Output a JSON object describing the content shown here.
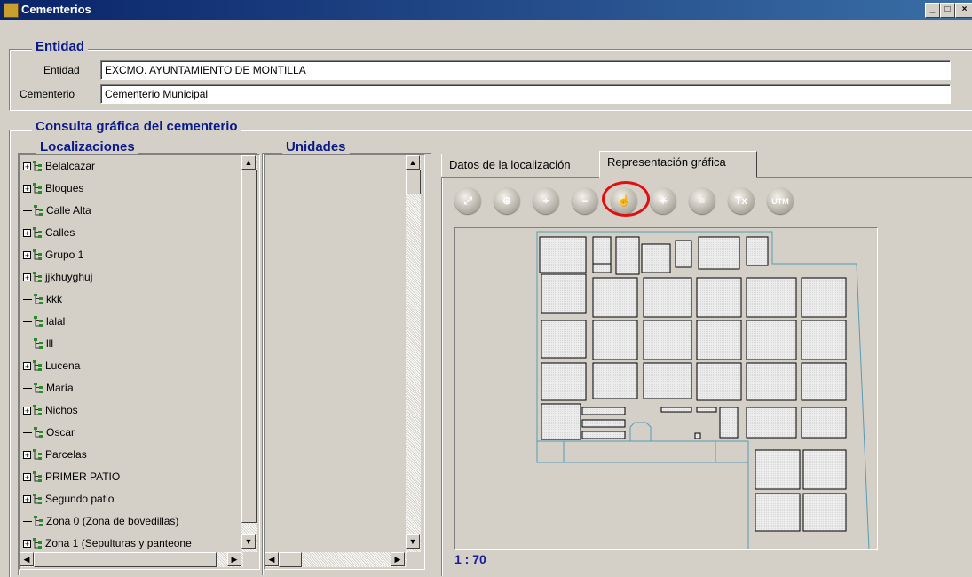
{
  "window": {
    "title": "Cementerios"
  },
  "entidad_section": {
    "title": "Entidad",
    "entidad_label": "Entidad",
    "entidad_value": "EXCMO. AYUNTAMIENTO DE MONTILLA",
    "cementerio_label": "Cementerio",
    "cementerio_value": "Cementerio Municipal"
  },
  "consulta_section": {
    "title": "Consulta gráfica del cementerio",
    "localizaciones_title": "Localizaciones",
    "unidades_title": "Unidades"
  },
  "localizaciones": [
    {
      "label": "Belalcazar",
      "expandable": true
    },
    {
      "label": "Bloques",
      "expandable": true
    },
    {
      "label": "Calle Alta",
      "expandable": false
    },
    {
      "label": "Calles",
      "expandable": true
    },
    {
      "label": "Grupo 1",
      "expandable": true
    },
    {
      "label": "jjkhuyghuj",
      "expandable": true
    },
    {
      "label": "kkk",
      "expandable": false
    },
    {
      "label": "lalal",
      "expandable": false
    },
    {
      "label": "lll",
      "expandable": false
    },
    {
      "label": "Lucena",
      "expandable": true
    },
    {
      "label": "María",
      "expandable": false
    },
    {
      "label": "Nichos",
      "expandable": true
    },
    {
      "label": "Oscar",
      "expandable": false
    },
    {
      "label": "Parcelas",
      "expandable": true
    },
    {
      "label": "PRIMER PATIO",
      "expandable": true
    },
    {
      "label": "Segundo patio",
      "expandable": true
    },
    {
      "label": "Zona 0 (Zona de bovedillas)",
      "expandable": false
    },
    {
      "label": "Zona 1 (Sepulturas y panteone",
      "expandable": true
    }
  ],
  "tabs": [
    {
      "label": "Datos de la localización",
      "active": false
    },
    {
      "label": "Representación gráfica",
      "active": true
    }
  ],
  "toolbar": [
    {
      "icon": "zoom-extent-icon",
      "glyph": "⤢"
    },
    {
      "icon": "zoom-window-icon",
      "glyph": "⊕"
    },
    {
      "icon": "zoom-in-icon",
      "glyph": "+"
    },
    {
      "icon": "zoom-out-icon",
      "glyph": "−"
    },
    {
      "icon": "pan-hand-icon",
      "glyph": "☝",
      "highlighted": true
    },
    {
      "icon": "center-icon",
      "glyph": "✳"
    },
    {
      "icon": "list-icon",
      "glyph": "≡"
    },
    {
      "icon": "text-icon",
      "glyph": "Tx"
    },
    {
      "icon": "utm-icon",
      "glyph": "UTM"
    }
  ],
  "map": {
    "scale_text": "1 : 70",
    "outline_color": "#5a9ab0"
  },
  "colors": {
    "title_bar": "#0a246a",
    "section_title": "#0a1a8a",
    "highlight_ring": "#e01010",
    "scale_text": "#1a1a9a"
  }
}
